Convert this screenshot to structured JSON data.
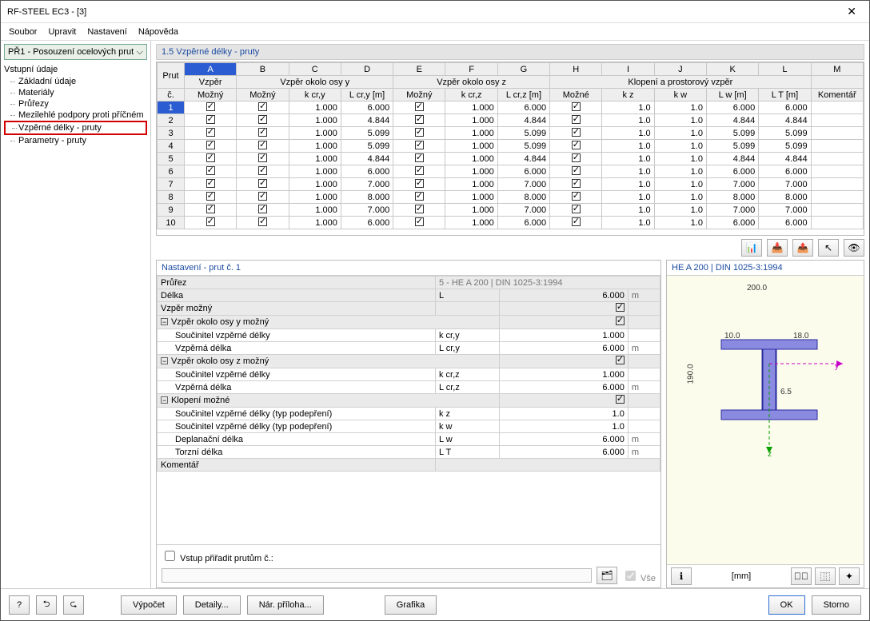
{
  "window": {
    "title": "RF-STEEL EC3 - [3]"
  },
  "menu": [
    "Soubor",
    "Upravit",
    "Nastavení",
    "Nápověda"
  ],
  "combo": "PŘ1 - Posouzení ocelových prut",
  "tree": {
    "root": "Vstupní údaje",
    "items": [
      "Základní údaje",
      "Materiály",
      "Průřezy",
      "Mezilehlé podpory proti příčném",
      "Vzpěrné délky - pruty",
      "Parametry - pruty"
    ],
    "active_index": 4
  },
  "section_title": "1.5 Vzpěrné délky - pruty",
  "grid": {
    "col_letters": [
      "A",
      "B",
      "C",
      "D",
      "E",
      "F",
      "G",
      "H",
      "I",
      "J",
      "K",
      "L",
      "M"
    ],
    "group1": "Vzpěr",
    "group2": "Vzpěr okolo osy y",
    "group3": "Vzpěr okolo osy z",
    "group4": "Klopení a prostorový vzpěr",
    "head_prut": "Prut č.",
    "heads": [
      "Možný",
      "Možný",
      "k cr,y",
      "L cr,y [m]",
      "Možný",
      "k cr,z",
      "L cr,z [m]",
      "Možné",
      "k z",
      "k w",
      "L w [m]",
      "L T [m]",
      "Komentář"
    ],
    "rows": [
      {
        "n": 1,
        "kcry": "1.000",
        "lcry": "6.000",
        "kcrz": "1.000",
        "lcrz": "6.000",
        "kz": "1.0",
        "kw": "1.0",
        "lw": "6.000",
        "lt": "6.000"
      },
      {
        "n": 2,
        "kcry": "1.000",
        "lcry": "4.844",
        "kcrz": "1.000",
        "lcrz": "4.844",
        "kz": "1.0",
        "kw": "1.0",
        "lw": "4.844",
        "lt": "4.844"
      },
      {
        "n": 3,
        "kcry": "1.000",
        "lcry": "5.099",
        "kcrz": "1.000",
        "lcrz": "5.099",
        "kz": "1.0",
        "kw": "1.0",
        "lw": "5.099",
        "lt": "5.099"
      },
      {
        "n": 4,
        "kcry": "1.000",
        "lcry": "5.099",
        "kcrz": "1.000",
        "lcrz": "5.099",
        "kz": "1.0",
        "kw": "1.0",
        "lw": "5.099",
        "lt": "5.099"
      },
      {
        "n": 5,
        "kcry": "1.000",
        "lcry": "4.844",
        "kcrz": "1.000",
        "lcrz": "4.844",
        "kz": "1.0",
        "kw": "1.0",
        "lw": "4.844",
        "lt": "4.844"
      },
      {
        "n": 6,
        "kcry": "1.000",
        "lcry": "6.000",
        "kcrz": "1.000",
        "lcrz": "6.000",
        "kz": "1.0",
        "kw": "1.0",
        "lw": "6.000",
        "lt": "6.000"
      },
      {
        "n": 7,
        "kcry": "1.000",
        "lcry": "7.000",
        "kcrz": "1.000",
        "lcrz": "7.000",
        "kz": "1.0",
        "kw": "1.0",
        "lw": "7.000",
        "lt": "7.000"
      },
      {
        "n": 8,
        "kcry": "1.000",
        "lcry": "8.000",
        "kcrz": "1.000",
        "lcrz": "8.000",
        "kz": "1.0",
        "kw": "1.0",
        "lw": "8.000",
        "lt": "8.000"
      },
      {
        "n": 9,
        "kcry": "1.000",
        "lcry": "7.000",
        "kcrz": "1.000",
        "lcrz": "7.000",
        "kz": "1.0",
        "kw": "1.0",
        "lw": "7.000",
        "lt": "7.000"
      },
      {
        "n": 10,
        "kcry": "1.000",
        "lcry": "6.000",
        "kcrz": "1.000",
        "lcrz": "6.000",
        "kz": "1.0",
        "kw": "1.0",
        "lw": "6.000",
        "lt": "6.000"
      }
    ]
  },
  "detail": {
    "title": "Nastavení - prut č. 1",
    "rows": [
      {
        "t": "hdr",
        "lbl": "Průřez",
        "sym": "",
        "val": "5 - HE A 200 | DIN 1025-3:1994",
        "unit": "",
        "span": true
      },
      {
        "t": "hdr",
        "lbl": "Délka",
        "sym": "L",
        "val": "6.000",
        "unit": "m"
      },
      {
        "t": "hdr",
        "lbl": "Vzpěr možný",
        "sym": "",
        "val": "[chk]",
        "unit": ""
      },
      {
        "t": "grp",
        "lbl": "Vzpěr okolo osy y možný",
        "val": "[chk]"
      },
      {
        "t": "row",
        "lbl": "Součinitel vzpěrné délky",
        "sym": "k cr,y",
        "val": "1.000",
        "unit": ""
      },
      {
        "t": "row",
        "lbl": "Vzpěrná délka",
        "sym": "L cr,y",
        "val": "6.000",
        "unit": "m"
      },
      {
        "t": "grp",
        "lbl": "Vzpěr okolo osy z možný",
        "val": "[chk]"
      },
      {
        "t": "row",
        "lbl": "Součinitel vzpěrné délky",
        "sym": "k cr,z",
        "val": "1.000",
        "unit": ""
      },
      {
        "t": "row",
        "lbl": "Vzpěrná délka",
        "sym": "L cr,z",
        "val": "6.000",
        "unit": "m"
      },
      {
        "t": "grp",
        "lbl": "Klopení možné",
        "val": "[chk]"
      },
      {
        "t": "row",
        "lbl": "Součinitel vzpěrné délky (typ podepření)",
        "sym": "k z",
        "val": "1.0",
        "unit": ""
      },
      {
        "t": "row",
        "lbl": "Součinitel vzpěrné délky (typ podepření)",
        "sym": "k w",
        "val": "1.0",
        "unit": ""
      },
      {
        "t": "row",
        "lbl": "Deplanační délka",
        "sym": "L w",
        "val": "6.000",
        "unit": "m"
      },
      {
        "t": "row",
        "lbl": "Torzní délka",
        "sym": "L T",
        "val": "6.000",
        "unit": "m"
      },
      {
        "t": "hdr",
        "lbl": "Komentář",
        "sym": "",
        "val": "",
        "unit": "",
        "span": true
      }
    ],
    "assign_label": "Vstup přiřadit prutům č.:",
    "all_label": "Vše"
  },
  "cross": {
    "title": "HE A 200 | DIN 1025-3:1994",
    "unit": "[mm]",
    "dims": {
      "b": "200.0",
      "h": "190.0",
      "tf": "10.0",
      "tw": "18.0",
      "r": "6.5"
    }
  },
  "footer": {
    "calc": "Výpočet",
    "details": "Detaily...",
    "annex": "Nár. příloha...",
    "grafika": "Grafika",
    "ok": "OK",
    "storno": "Storno"
  }
}
